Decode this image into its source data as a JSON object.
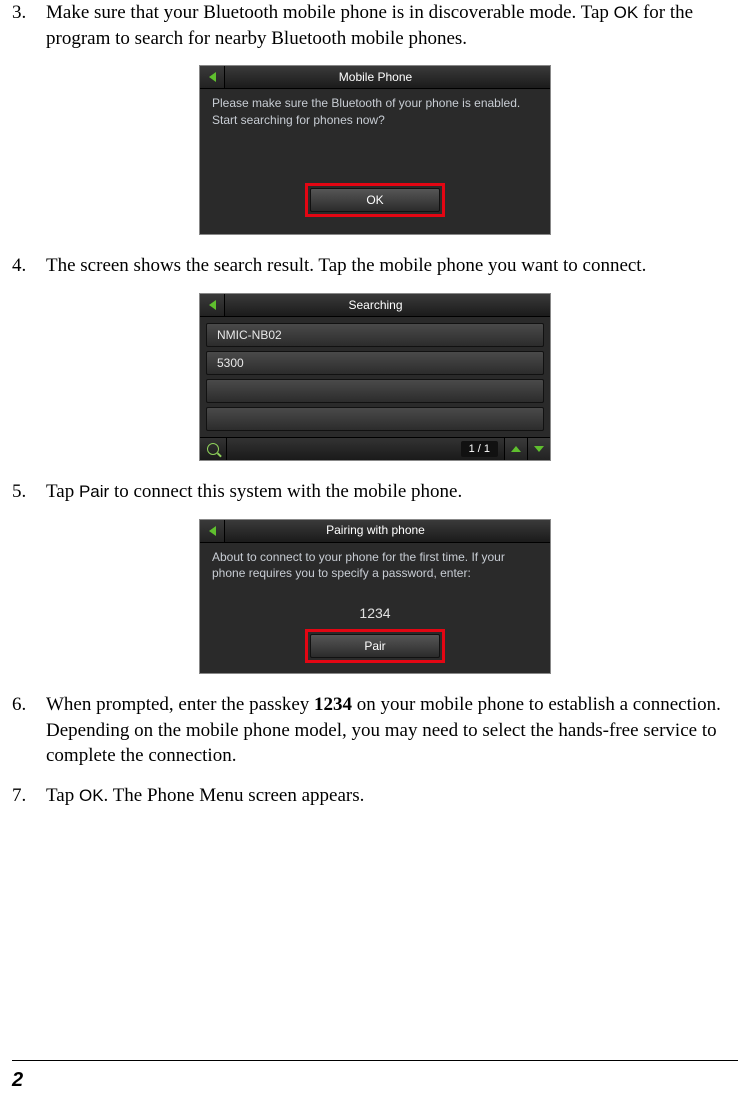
{
  "steps": {
    "s3": {
      "num": "3.",
      "text_pre": "Make sure that your Bluetooth mobile phone is in discoverable mode. Tap ",
      "ok": "OK",
      "text_post": " for the program to search for nearby Bluetooth mobile phones."
    },
    "s4": {
      "num": "4.",
      "text": "The screen shows the search result. Tap the mobile phone you want to connect."
    },
    "s5": {
      "num": "5.",
      "text_pre": "Tap ",
      "pair": "Pair",
      "text_post": " to connect this system with the mobile phone."
    },
    "s6": {
      "num": "6.",
      "text_pre": "When prompted, enter the passkey ",
      "pass": "1234",
      "text_post": " on your mobile phone to establish a connection. Depending on the mobile phone model, you may need to select the hands-free service to complete the connection."
    },
    "s7": {
      "num": "7.",
      "text_pre": "Tap ",
      "ok": "OK",
      "text_post": ". The Phone Menu screen appears."
    }
  },
  "shot1": {
    "title": "Mobile Phone",
    "msg": "Please make sure the Bluetooth of your phone is enabled. Start searching for phones now?",
    "btn": "OK"
  },
  "shot2": {
    "title": "Searching",
    "items": [
      "NMIC-NB02",
      "5300",
      "",
      ""
    ],
    "page": "1 / 1"
  },
  "shot3": {
    "title": "Pairing with phone",
    "msg": "About to connect to your phone for the first time. If your phone requires you to specify a password, enter:",
    "pass": "1234",
    "btn": "Pair"
  },
  "page_number": "2"
}
